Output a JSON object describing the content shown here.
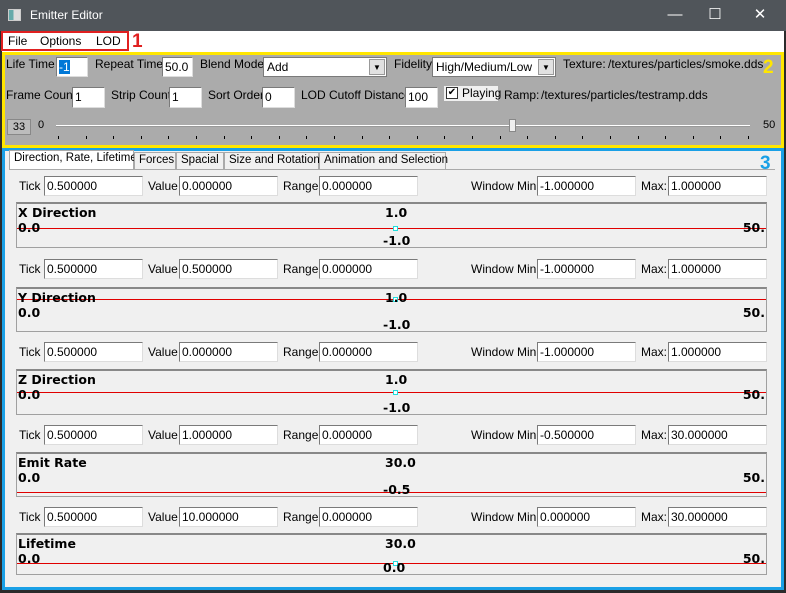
{
  "window": {
    "title": "Emitter Editor",
    "minimize": "—",
    "maximize": "☐",
    "close": "✕"
  },
  "menu": [
    "File",
    "Options",
    "LOD"
  ],
  "annotations": [
    "1",
    "2",
    "3"
  ],
  "settings": {
    "life_time_label": "Life Time",
    "life_time": "-1",
    "repeat_time_label": "Repeat Time",
    "repeat_time": "50.0",
    "blend_mode_label": "Blend Mode",
    "blend_mode": "Add",
    "fidelity_label": "Fidelity",
    "fidelity": "High/Medium/Low",
    "texture_label": "Texture:",
    "texture": "/textures/particles/smoke.dds",
    "frame_count_label": "Frame Count",
    "frame_count": "1",
    "strip_count_label": "Strip Count",
    "strip_count": "1",
    "sort_order_label": "Sort Order",
    "sort_order": "0",
    "lod_cutoff_label": "LOD Cutoff Distance",
    "lod_cutoff": "100",
    "playing_label": "Playing",
    "playing": true,
    "ramp_label": "Ramp:",
    "ramp": "/textures/particles/testramp.dds",
    "frame": "33",
    "slider_min": "0",
    "slider_max": "50",
    "slider_value": 33
  },
  "tabs": [
    "Direction, Rate, Lifetime",
    "Forces",
    "Spacial",
    "Size and Rotation",
    "Animation and Selection"
  ],
  "labels": {
    "tick": "Tick",
    "value": "Value",
    "range": "Range",
    "window_min": "Window Min:",
    "max": "Max:"
  },
  "curves": [
    {
      "title": "X Direction",
      "tick": "0.500000",
      "value": "0.000000",
      "range": "0.000000",
      "min": "-1.000000",
      "max": "1.000000",
      "top_label": "1.0",
      "bottom_label": "-1.0",
      "left_label": "0.0",
      "right_label": "50."
    },
    {
      "title": "Y Direction",
      "tick": "0.500000",
      "value": "0.500000",
      "range": "0.000000",
      "min": "-1.000000",
      "max": "1.000000",
      "top_label": "1.0",
      "bottom_label": "-1.0",
      "left_label": "0.0",
      "right_label": "50."
    },
    {
      "title": "Z Direction",
      "tick": "0.500000",
      "value": "0.000000",
      "range": "0.000000",
      "min": "-1.000000",
      "max": "1.000000",
      "top_label": "1.0",
      "bottom_label": "-1.0",
      "left_label": "0.0",
      "right_label": "50."
    },
    {
      "title": "Emit Rate",
      "tick": "0.500000",
      "value": "1.000000",
      "range": "0.000000",
      "min": "-0.500000",
      "max": "30.000000",
      "top_label": "30.0",
      "bottom_label": "-0.5",
      "left_label": "0.0",
      "right_label": "50."
    },
    {
      "title": "Lifetime",
      "tick": "0.500000",
      "value": "10.000000",
      "range": "0.000000",
      "min": "0.000000",
      "max": "30.000000",
      "top_label": "30.0",
      "bottom_label": "0.0",
      "left_label": "0.0",
      "right_label": "50."
    }
  ]
}
